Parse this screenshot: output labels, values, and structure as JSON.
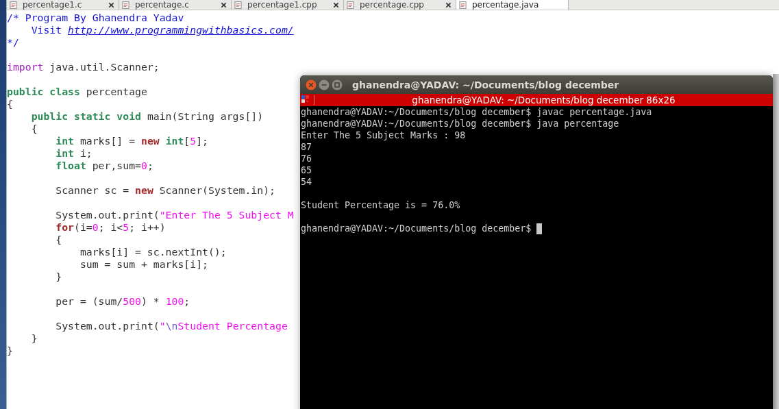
{
  "editor": {
    "tabs": [
      {
        "label": "percentage1.c",
        "selected": false
      },
      {
        "label": "percentage.c",
        "selected": false
      },
      {
        "label": "percentage1.cpp",
        "selected": false
      },
      {
        "label": "percentage.cpp",
        "selected": false
      },
      {
        "label": "percentage.java",
        "selected": true
      }
    ],
    "lines": [
      {
        "kind": "code",
        "tokens": [
          {
            "kind": "comment",
            "text": "/* Program By Ghanendra Yadav"
          }
        ]
      },
      {
        "kind": "code",
        "tokens": [
          {
            "kind": "comment",
            "text": "    Visit "
          },
          {
            "kind": "link",
            "text": "http://www.programmingwithbasics.com/"
          }
        ]
      },
      {
        "kind": "code",
        "tokens": [
          {
            "kind": "comment",
            "text": "*/"
          }
        ]
      },
      {
        "kind": "blank"
      },
      {
        "kind": "code",
        "tokens": [
          {
            "kind": "import",
            "text": "import"
          },
          {
            "kind": "plain",
            "text": " java.util.Scanner;"
          }
        ]
      },
      {
        "kind": "blank"
      },
      {
        "kind": "code",
        "tokens": [
          {
            "kind": "type",
            "text": "public class"
          },
          {
            "kind": "plain",
            "text": " percentage"
          }
        ]
      },
      {
        "kind": "code",
        "tokens": [
          {
            "kind": "plain",
            "text": "{"
          }
        ],
        "children": [
          {
            "kind": "code",
            "tokens": [
              {
                "kind": "type",
                "text": "public static void"
              },
              {
                "kind": "plain",
                "text": " main(String args[])"
              }
            ]
          },
          {
            "kind": "code",
            "tokens": [
              {
                "kind": "plain",
                "text": "{"
              }
            ],
            "children": [
              {
                "kind": "code",
                "tokens": [
                  {
                    "kind": "type",
                    "text": "int"
                  },
                  {
                    "kind": "plain",
                    "text": " marks[] = "
                  },
                  {
                    "kind": "keyword",
                    "text": "new"
                  },
                  {
                    "kind": "type",
                    "text": " int"
                  },
                  {
                    "kind": "plain",
                    "text": "["
                  },
                  {
                    "kind": "literal",
                    "text": "5"
                  },
                  {
                    "kind": "plain",
                    "text": "];"
                  }
                ]
              },
              {
                "kind": "code",
                "tokens": [
                  {
                    "kind": "type",
                    "text": "int"
                  },
                  {
                    "kind": "plain",
                    "text": " i;"
                  }
                ]
              },
              {
                "kind": "code",
                "tokens": [
                  {
                    "kind": "type",
                    "text": "float"
                  },
                  {
                    "kind": "plain",
                    "text": " per,sum="
                  },
                  {
                    "kind": "literal",
                    "text": "0"
                  },
                  {
                    "kind": "plain",
                    "text": ";"
                  }
                ]
              },
              {
                "kind": "blank"
              },
              {
                "kind": "code",
                "tokens": [
                  {
                    "kind": "plain",
                    "text": "Scanner sc = "
                  },
                  {
                    "kind": "keyword",
                    "text": "new"
                  },
                  {
                    "kind": "plain",
                    "text": " Scanner(System.in);"
                  }
                ]
              },
              {
                "kind": "blank"
              },
              {
                "kind": "code",
                "tokens": [
                  {
                    "kind": "plain",
                    "text": "System.out.print("
                  },
                  {
                    "kind": "literal",
                    "text": "\"Enter The 5 Subject M"
                  }
                ]
              },
              {
                "kind": "code",
                "tokens": [
                  {
                    "kind": "keyword",
                    "text": "for"
                  },
                  {
                    "kind": "plain",
                    "text": "(i="
                  },
                  {
                    "kind": "literal",
                    "text": "0"
                  },
                  {
                    "kind": "plain",
                    "text": "; i<"
                  },
                  {
                    "kind": "literal",
                    "text": "5"
                  },
                  {
                    "kind": "plain",
                    "text": "; i++)"
                  }
                ]
              },
              {
                "kind": "code",
                "tokens": [
                  {
                    "kind": "plain",
                    "text": "{"
                  }
                ],
                "children": [
                  {
                    "kind": "code",
                    "tokens": [
                      {
                        "kind": "plain",
                        "text": "marks[i] = sc.nextInt();"
                      }
                    ]
                  },
                  {
                    "kind": "code",
                    "tokens": [
                      {
                        "kind": "plain",
                        "text": "sum = sum + marks[i];"
                      }
                    ]
                  }
                ]
              },
              {
                "kind": "code",
                "tokens": [
                  {
                    "kind": "plain",
                    "text": "}"
                  }
                ]
              },
              {
                "kind": "blank"
              },
              {
                "kind": "code",
                "tokens": [
                  {
                    "kind": "plain",
                    "text": "per = (sum/"
                  },
                  {
                    "kind": "literal",
                    "text": "500"
                  },
                  {
                    "kind": "plain",
                    "text": ") * "
                  },
                  {
                    "kind": "literal",
                    "text": "100"
                  },
                  {
                    "kind": "plain",
                    "text": ";"
                  }
                ]
              },
              {
                "kind": "blank"
              },
              {
                "kind": "code",
                "tokens": [
                  {
                    "kind": "plain",
                    "text": "System.out.print("
                  },
                  {
                    "kind": "literal",
                    "text": "\""
                  },
                  {
                    "kind": "escape",
                    "text": "\\n"
                  },
                  {
                    "kind": "literal",
                    "text": "Student Percentage"
                  }
                ]
              }
            ]
          },
          {
            "kind": "code",
            "tokens": [
              {
                "kind": "plain",
                "text": "}"
              }
            ]
          }
        ]
      },
      {
        "kind": "code",
        "tokens": [
          {
            "kind": "plain",
            "text": "}"
          }
        ]
      }
    ]
  },
  "terminal": {
    "title": "ghanendra@YADAV: ~/Documents/blog december",
    "tab_title": "ghanendra@YADAV: ~/Documents/blog december 86x26",
    "lines": [
      {
        "kind": "output",
        "text": "ghanendra@YADAV:~/Documents/blog december$ javac percentage.java"
      },
      {
        "kind": "output",
        "text": "ghanendra@YADAV:~/Documents/blog december$ java percentage"
      },
      {
        "kind": "output",
        "text": "Enter The 5 Subject Marks : 98"
      },
      {
        "kind": "output",
        "text": "87"
      },
      {
        "kind": "output",
        "text": "76"
      },
      {
        "kind": "output",
        "text": "65"
      },
      {
        "kind": "output",
        "text": "54"
      },
      {
        "kind": "blank"
      },
      {
        "kind": "output",
        "text": "Student Percentage is = 76.0%"
      },
      {
        "kind": "blank"
      },
      {
        "kind": "output",
        "text": "ghanendra@YADAV:~/Documents/blog december$",
        "cursor": true
      }
    ]
  }
}
